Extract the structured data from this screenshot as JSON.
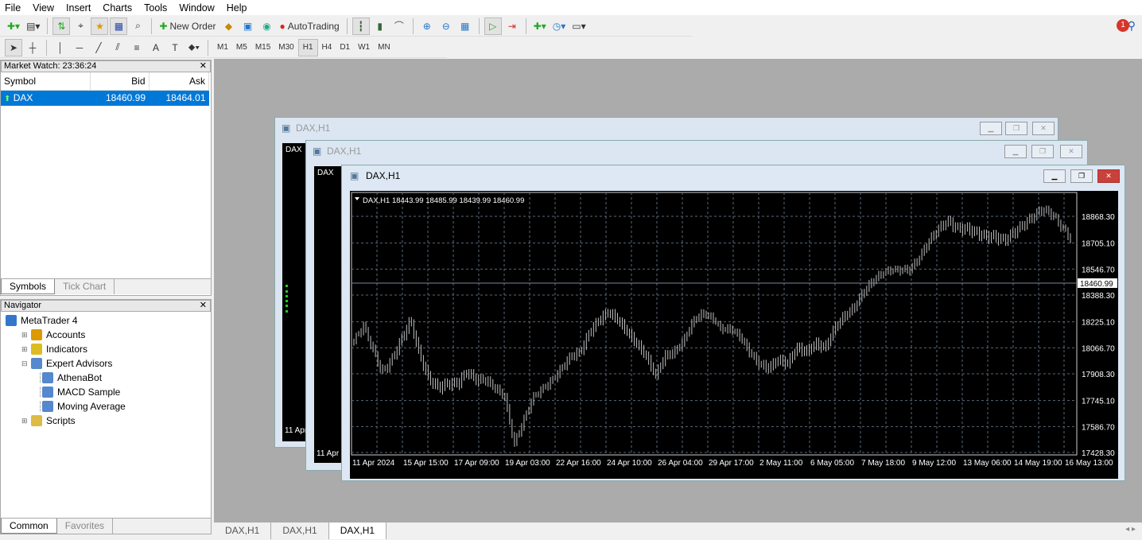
{
  "menu": [
    "File",
    "View",
    "Insert",
    "Charts",
    "Tools",
    "Window",
    "Help"
  ],
  "toolbar": {
    "new_order": "New Order",
    "autotrading": "AutoTrading",
    "notifications": "1"
  },
  "timeframes": [
    "M1",
    "M5",
    "M15",
    "M30",
    "H1",
    "H4",
    "D1",
    "W1",
    "MN"
  ],
  "active_timeframe": "H1",
  "market_watch": {
    "title": "Market Watch: 23:36:24",
    "columns": [
      "Symbol",
      "Bid",
      "Ask"
    ],
    "rows": [
      {
        "symbol": "DAX",
        "bid": "18460.99",
        "ask": "18464.01"
      }
    ],
    "tabs": [
      "Symbols",
      "Tick Chart"
    ]
  },
  "navigator": {
    "title": "Navigator",
    "items": [
      {
        "label": "MetaTrader 4",
        "level": 0,
        "icon": "terminal-icon"
      },
      {
        "label": "Accounts",
        "level": 1,
        "icon": "accounts-icon"
      },
      {
        "label": "Indicators",
        "level": 1,
        "icon": "indicators-icon"
      },
      {
        "label": "Expert Advisors",
        "level": 1,
        "icon": "expert-advisors-icon"
      },
      {
        "label": "AthenaBot",
        "level": 2,
        "icon": "expert-icon"
      },
      {
        "label": "MACD Sample",
        "level": 2,
        "icon": "expert-icon"
      },
      {
        "label": "Moving Average",
        "level": 2,
        "icon": "expert-icon"
      },
      {
        "label": "Scripts",
        "level": 1,
        "icon": "scripts-icon"
      }
    ],
    "tabs": [
      "Common",
      "Favorites"
    ]
  },
  "windows": [
    {
      "title": "DAX,H1"
    },
    {
      "title": "DAX,H1"
    },
    {
      "title": "DAX,H1"
    }
  ],
  "bg_chart_labels": {
    "label": "DAX",
    "date": "11 Apr"
  },
  "bottom_tabs": [
    "DAX,H1",
    "DAX,H1",
    "DAX,H1"
  ],
  "chart_data": {
    "type": "ohlc",
    "symbol_info": "DAX,H1  18443.99 18485.99 18439.99 18460.99",
    "current_price": 18460.99,
    "current_price_label": "18460.99",
    "ylim": [
      17428.3,
      18948
    ],
    "y_ticks": [
      "18868.30",
      "18705.10",
      "18546.70",
      "18388.30",
      "18225.10",
      "18066.70",
      "17908.30",
      "17745.10",
      "17586.70",
      "17428.30"
    ],
    "x_ticks": [
      "11 Apr 2024",
      "15 Apr 15:00",
      "17 Apr 09:00",
      "19 Apr 03:00",
      "22 Apr 16:00",
      "24 Apr 10:00",
      "26 Apr 04:00",
      "29 Apr 17:00",
      "2 May 11:00",
      "6 May 05:00",
      "7 May 18:00",
      "9 May 12:00",
      "13 May 06:00",
      "14 May 19:00",
      "16 May 13:00"
    ],
    "grid": true,
    "closes": [
      18112,
      18208,
      18063,
      17918,
      17991,
      18112,
      18233,
      18015,
      17869,
      17821,
      17845,
      17845,
      17918,
      17869,
      17869,
      17821,
      17772,
      17482,
      17627,
      17772,
      17821,
      17869,
      17942,
      18015,
      18039,
      18160,
      18233,
      18282,
      18233,
      18160,
      18088,
      18015,
      17894,
      18015,
      18039,
      18112,
      18233,
      18282,
      18257,
      18185,
      18185,
      18136,
      18039,
      17967,
      17942,
      17991,
      17967,
      18063,
      18039,
      18088,
      18063,
      18185,
      18257,
      18306,
      18403,
      18475,
      18524,
      18548,
      18548,
      18548,
      18621,
      18718,
      18791,
      18839,
      18791,
      18791,
      18766,
      18742,
      18742,
      18718,
      18766,
      18815,
      18863,
      18912,
      18888,
      18815,
      18742
    ],
    "colors": {
      "background": "#000000",
      "bars": "#c0c0c0",
      "grid": "#5a6a7a",
      "text": "#ffffff",
      "price_line": "#778899"
    }
  }
}
